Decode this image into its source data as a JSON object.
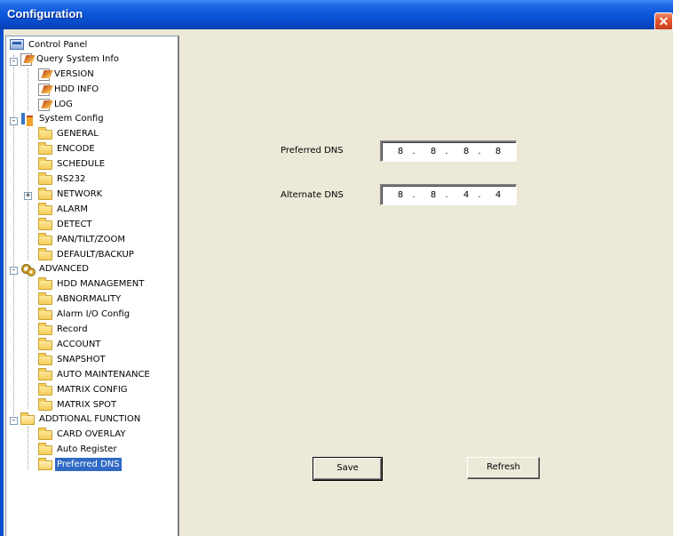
{
  "window": {
    "title": "Configuration",
    "close_glyph": "✕"
  },
  "tree": {
    "items": [
      {
        "label": "Control Panel",
        "icon": "panel-icon"
      },
      {
        "label": "Query System Info",
        "icon": "edit-icon"
      },
      {
        "label": "VERSION",
        "icon": "edit-icon"
      },
      {
        "label": "HDD INFO",
        "icon": "edit-icon"
      },
      {
        "label": "LOG",
        "icon": "edit-icon"
      },
      {
        "label": "System Config",
        "icon": "system-config-icon"
      },
      {
        "label": "GENERAL",
        "icon": "folder-icon"
      },
      {
        "label": "ENCODE",
        "icon": "folder-icon"
      },
      {
        "label": "SCHEDULE",
        "icon": "folder-icon"
      },
      {
        "label": "RS232",
        "icon": "folder-icon"
      },
      {
        "label": "NETWORK",
        "icon": "folder-icon"
      },
      {
        "label": "ALARM",
        "icon": "folder-icon"
      },
      {
        "label": "DETECT",
        "icon": "folder-icon"
      },
      {
        "label": "PAN/TILT/ZOOM",
        "icon": "folder-icon"
      },
      {
        "label": "DEFAULT/BACKUP",
        "icon": "folder-icon"
      },
      {
        "label": "ADVANCED",
        "icon": "gears-icon"
      },
      {
        "label": "HDD MANAGEMENT",
        "icon": "folder-icon"
      },
      {
        "label": "ABNORMALITY",
        "icon": "folder-icon"
      },
      {
        "label": "Alarm I/O Config",
        "icon": "folder-icon"
      },
      {
        "label": "Record",
        "icon": "folder-icon"
      },
      {
        "label": "ACCOUNT",
        "icon": "folder-icon"
      },
      {
        "label": "SNAPSHOT",
        "icon": "folder-icon"
      },
      {
        "label": "AUTO MAINTENANCE",
        "icon": "folder-icon"
      },
      {
        "label": "MATRIX CONFIG",
        "icon": "folder-icon"
      },
      {
        "label": "MATRIX SPOT",
        "icon": "folder-icon"
      },
      {
        "label": "ADDTIONAL FUNCTION",
        "icon": "folder-icon"
      },
      {
        "label": "CARD OVERLAY",
        "icon": "folder-icon"
      },
      {
        "label": "Auto Register",
        "icon": "folder-icon"
      },
      {
        "label": "Preferred DNS",
        "icon": "folder-open-icon",
        "selected": true
      }
    ],
    "expand_glyph": "-",
    "collapse_glyph": "+"
  },
  "form": {
    "preferred_dns_label": "Preferred DNS",
    "preferred_dns": [
      "8",
      "8",
      "8",
      "8"
    ],
    "alternate_dns_label": "Alternate DNS",
    "alternate_dns": [
      "8",
      "8",
      "4",
      "4"
    ],
    "dot": "."
  },
  "buttons": {
    "save_label": "Save",
    "refresh_label": "Refresh"
  },
  "colors": {
    "titlebar": "#0a55d8",
    "selection": "#316ac5",
    "panel_bg": "#ece9d8"
  }
}
